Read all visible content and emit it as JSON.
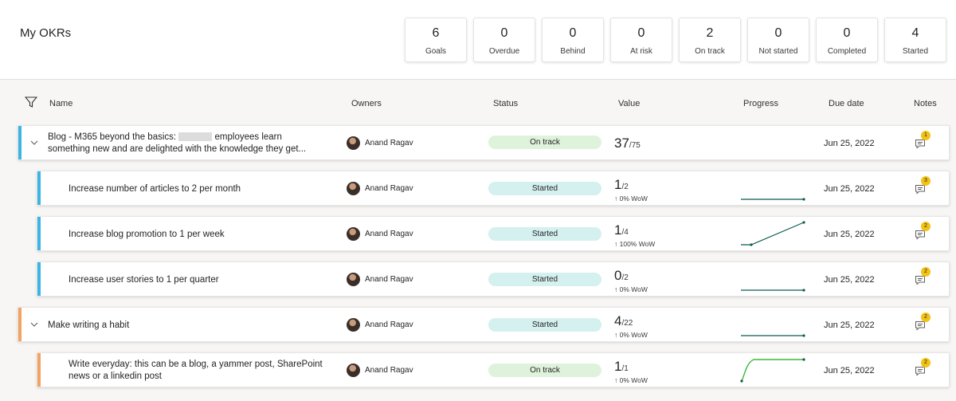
{
  "header": {
    "title": "My OKRs",
    "kpis": [
      {
        "value": "6",
        "label": "Goals"
      },
      {
        "value": "0",
        "label": "Overdue"
      },
      {
        "value": "0",
        "label": "Behind"
      },
      {
        "value": "0",
        "label": "At risk"
      },
      {
        "value": "2",
        "label": "On track"
      },
      {
        "value": "0",
        "label": "Not started"
      },
      {
        "value": "0",
        "label": "Completed"
      },
      {
        "value": "4",
        "label": "Started"
      }
    ]
  },
  "columns": {
    "name": "Name",
    "owners": "Owners",
    "status": "Status",
    "value": "Value",
    "progress": "Progress",
    "due": "Due date",
    "notes": "Notes"
  },
  "colors": {
    "blue_accent": "#3bb5e5",
    "orange_accent": "#f4a261",
    "spark_dark": "#0b5a4f",
    "spark_green": "#3cb93c",
    "badge": "#f2c316"
  },
  "rows": [
    {
      "name_line1": "Blog - M365 beyond the basics:",
      "name_tail": "employees learn",
      "name_line2": "something new and are delighted with the knowledge they get...",
      "owner": "Anand Ragav",
      "status": "On track",
      "value": "37",
      "total": "/75",
      "wow": "",
      "due": "Jun 25, 2022",
      "notes": "1"
    },
    {
      "name_line1": "Increase number of articles to 2 per month",
      "owner": "Anand Ragav",
      "status": "Started",
      "value": "1",
      "total": "/2",
      "wow": "↑ 0% WoW",
      "due": "Jun 25, 2022",
      "notes": "3"
    },
    {
      "name_line1": "Increase blog promotion to 1 per week",
      "owner": "Anand Ragav",
      "status": "Started",
      "value": "1",
      "total": "/4",
      "wow": "↑ 100% WoW",
      "due": "Jun 25, 2022",
      "notes": "2"
    },
    {
      "name_line1": "Increase user stories to 1 per quarter",
      "owner": "Anand Ragav",
      "status": "Started",
      "value": "0",
      "total": "/2",
      "wow": "↑ 0% WoW",
      "due": "Jun 25, 2022",
      "notes": "2"
    },
    {
      "name_line1": "Make writing a habit",
      "owner": "Anand Ragav",
      "status": "Started",
      "value": "4",
      "total": "/22",
      "wow": "↑ 0% WoW",
      "due": "Jun 25, 2022",
      "notes": "2"
    },
    {
      "name_line1": "Write everyday: this can be a blog, a yammer post, SharePoint",
      "name_line2": "news or a linkedin post",
      "owner": "Anand Ragav",
      "status": "On track",
      "value": "1",
      "total": "/1",
      "wow": "↑ 0% WoW",
      "due": "Jun 25, 2022",
      "notes": "2"
    }
  ]
}
